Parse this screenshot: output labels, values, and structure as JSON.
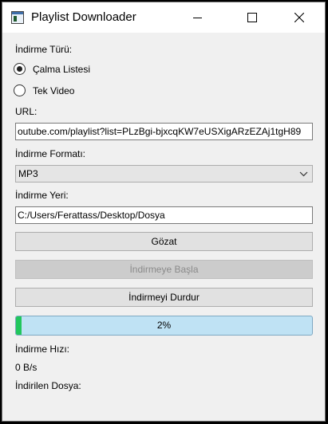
{
  "window": {
    "title": "Playlist Downloader",
    "controls": {
      "minimize": "minimize-icon",
      "maximize": "maximize-icon",
      "close": "close-icon"
    }
  },
  "form": {
    "download_type_label": "İndirme Türü:",
    "radio_options": [
      {
        "label": "Çalma Listesi",
        "selected": true
      },
      {
        "label": "Tek Video",
        "selected": false
      }
    ],
    "url_label": "URL:",
    "url_value": "outube.com/playlist?list=PLzBgi-bjxcqKW7eUSXigARzEZAj1tgH89",
    "format_label": "İndirme Formatı:",
    "format_value": "MP3",
    "location_label": "İndirme Yeri:",
    "location_value": "C:/Users/Ferattass/Desktop/Dosya"
  },
  "buttons": {
    "browse": "Gözat",
    "start": "İndirmeye Başla",
    "stop": "İndirmeyi Durdur"
  },
  "progress": {
    "percent": 2,
    "text": "2%"
  },
  "status": {
    "speed_label": "İndirme Hızı:",
    "speed_value": "0 B/s",
    "downloaded_label": "İndirilen Dosya:"
  },
  "colors": {
    "progress_fill": "#21c65c",
    "progress_track": "#bfe2f4"
  }
}
